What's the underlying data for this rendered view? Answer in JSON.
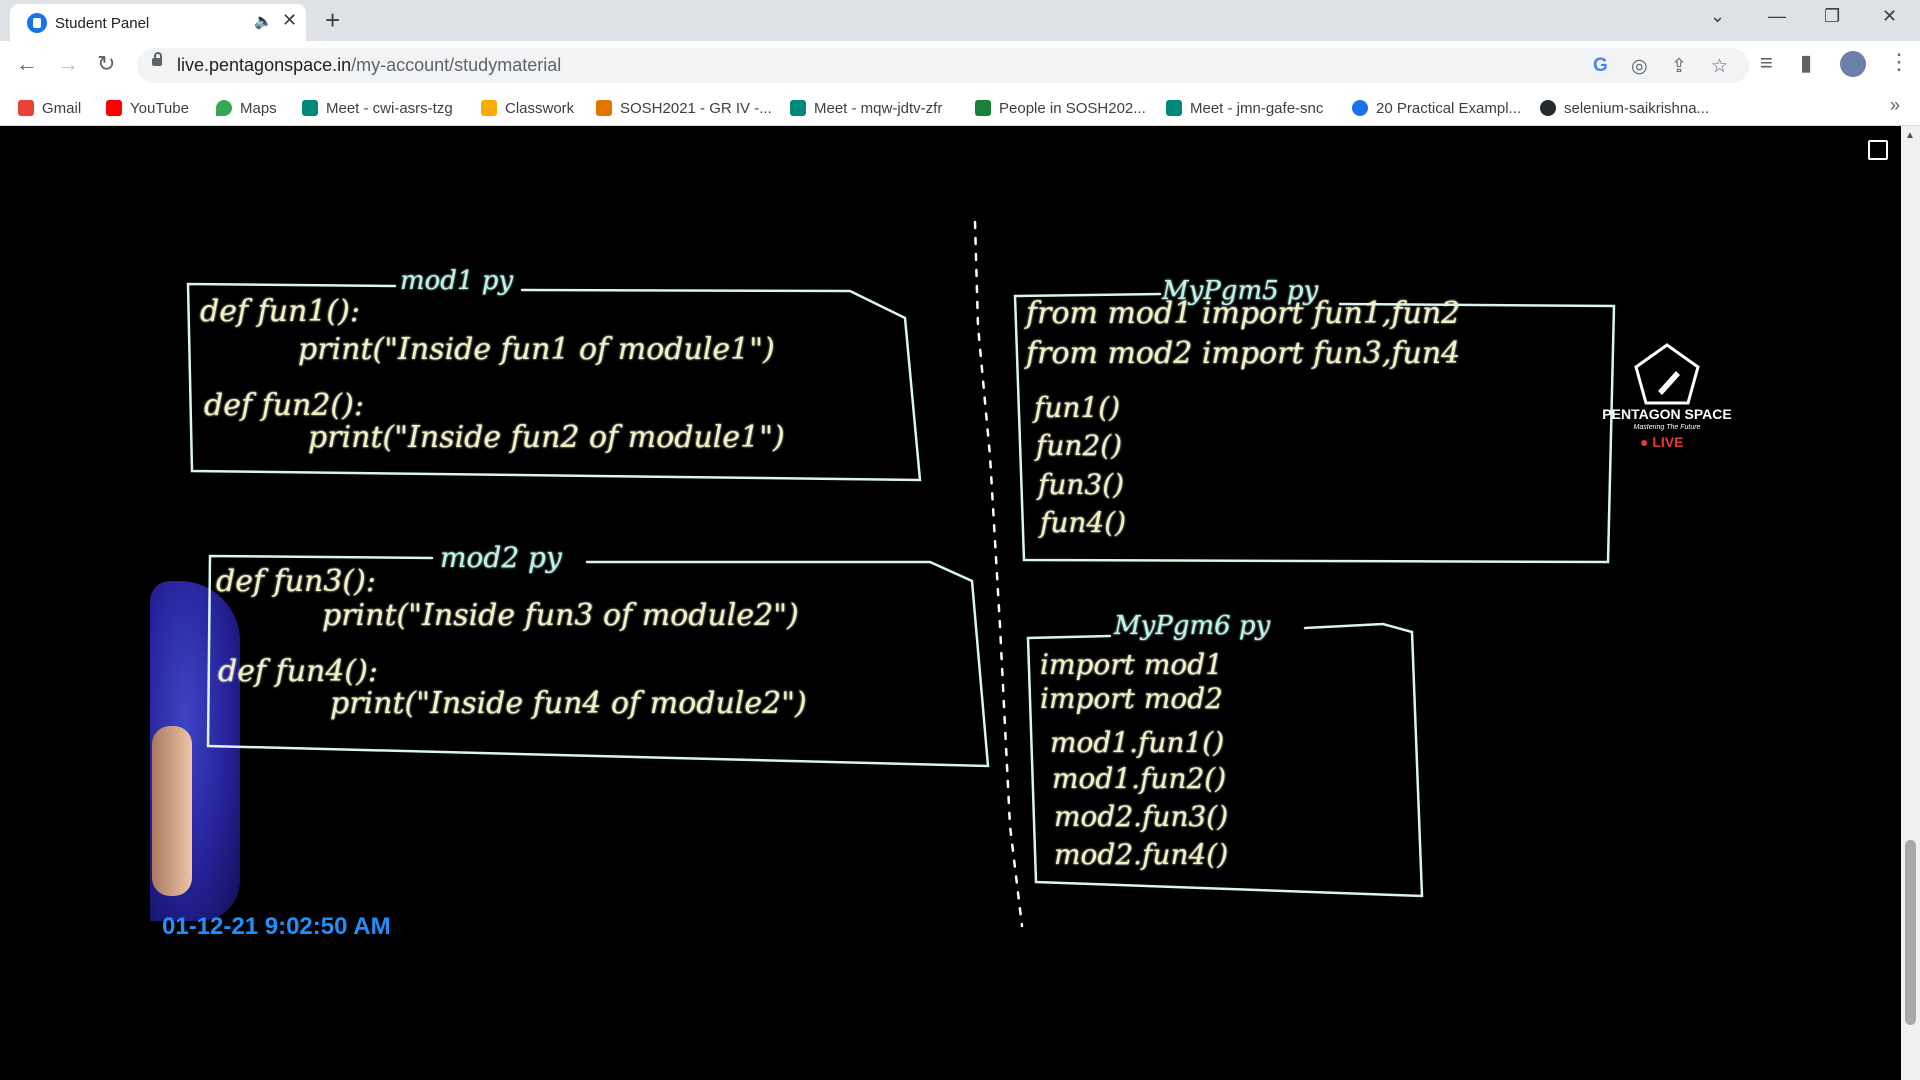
{
  "tab": {
    "title": "Student Panel"
  },
  "address": {
    "domain": "live.pentagonspace.in",
    "path": "/my-account/studymaterial"
  },
  "bookmarks": [
    {
      "label": "Gmail",
      "color": "#ea4335"
    },
    {
      "label": "YouTube",
      "color": "#ff0000"
    },
    {
      "label": "Maps",
      "color": "#34a853"
    },
    {
      "label": "Meet - cwi-asrs-tzg",
      "color": "#00897b"
    },
    {
      "label": "Classwork",
      "color": "#f9ab00"
    },
    {
      "label": "SOSH2021 - GR IV -...",
      "color": "#e37400"
    },
    {
      "label": "Meet - mqw-jdtv-zfr",
      "color": "#00897b"
    },
    {
      "label": "People in SOSH202...",
      "color": "#188038"
    },
    {
      "label": "Meet - jmn-gafe-snc",
      "color": "#00897b"
    },
    {
      "label": "20 Practical Exampl...",
      "color": "#1a73e8"
    },
    {
      "label": "selenium-saikrishna...",
      "color": "#24292e"
    }
  ],
  "logo": {
    "name": "PENTAGON SPACE",
    "tagline": "Mastering The Future",
    "live": "LIVE"
  },
  "timestamp": "01-12-21 9:02:50 AM",
  "board": {
    "mod1_title": "mod1 py",
    "mod1_lines": [
      "def fun1():",
      "print(\"Inside fun1 of module1\")",
      "def fun2():",
      "print(\"Inside fun2 of module1\")"
    ],
    "mod2_title": "mod2 py",
    "mod2_lines": [
      "def fun3():",
      "print(\"Inside fun3 of module2\")",
      "def fun4():",
      "print(\"Inside fun4 of module2\")"
    ],
    "pgm5_title": "MyPgm5 py",
    "pgm5_lines": [
      "from mod1 import fun1,fun2",
      "from mod2 import fun3,fun4",
      "fun1()",
      "fun2()",
      "fun3()",
      "fun4()"
    ],
    "pgm6_title": "MyPgm6 py",
    "pgm6_lines": [
      "import mod1",
      "import mod2",
      "mod1.fun1()",
      "mod1.fun2()",
      "mod2.fun3()",
      "mod2.fun4()"
    ]
  }
}
